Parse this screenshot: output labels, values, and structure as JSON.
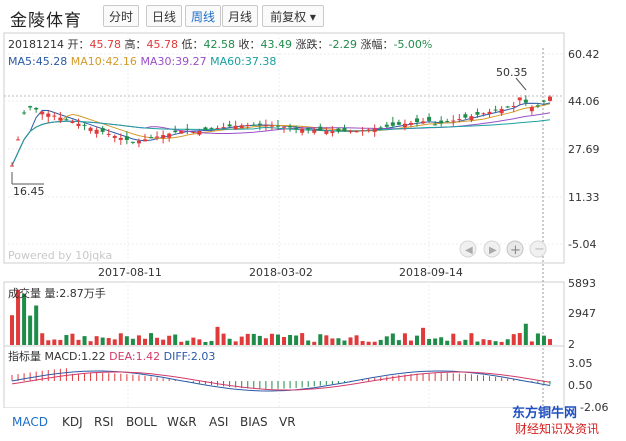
{
  "header": {
    "title": "金陵体育",
    "buttons": [
      "分时",
      "日线",
      "周线",
      "月线",
      "前复权 ▾"
    ],
    "active_button": "周线"
  },
  "quote": {
    "date": "20181214",
    "open_label": "开：",
    "open": "45.78",
    "high_label": "高：",
    "high": "45.78",
    "low_label": "低：",
    "low": "42.58",
    "close_label": "收：",
    "close": "43.49",
    "change_label": "涨跌：",
    "change": "-2.29",
    "pct_label": "涨幅：",
    "pct": "-5.00%"
  },
  "ma": {
    "ma5": "MA5:45.28",
    "ma10": "MA10:42.16",
    "ma30": "MA30:39.27",
    "ma60": "MA60:37.38"
  },
  "price_axis": [
    "60.42",
    "44.06",
    "27.69",
    "11.33",
    "-5.04"
  ],
  "annotations": {
    "high": "50.35",
    "low": "16.45"
  },
  "powered": "Powered by 10jqka",
  "date_axis": [
    "2017-08-11",
    "2018-03-02",
    "2018-09-14"
  ],
  "volume": {
    "label": "成交量",
    "qty": "量:2.87万手",
    "axis": [
      "5893",
      "2947",
      "2"
    ]
  },
  "indicator": {
    "label": "指标量",
    "macd": "MACD:1.22",
    "dea": "DEA:1.42",
    "diff": "DIFF:2.03",
    "axis": [
      "3.05",
      "0.50",
      "-2.06"
    ]
  },
  "tabs": [
    "MACD",
    "KDJ",
    "RSI",
    "BOLL",
    "W&R",
    "ASI",
    "BIAS",
    "VR"
  ],
  "active_tab": "MACD",
  "watermark": {
    "line1": "东方铜牛网",
    "line2": "财经知识及资讯"
  },
  "colors": {
    "up": "#e03a3a",
    "down": "#1f8c4a",
    "ma5": "#2b5aa6",
    "ma10": "#d59a2a",
    "ma30": "#9a4fc9",
    "ma60": "#1aa0a0",
    "active": "#1e6ec8"
  }
}
